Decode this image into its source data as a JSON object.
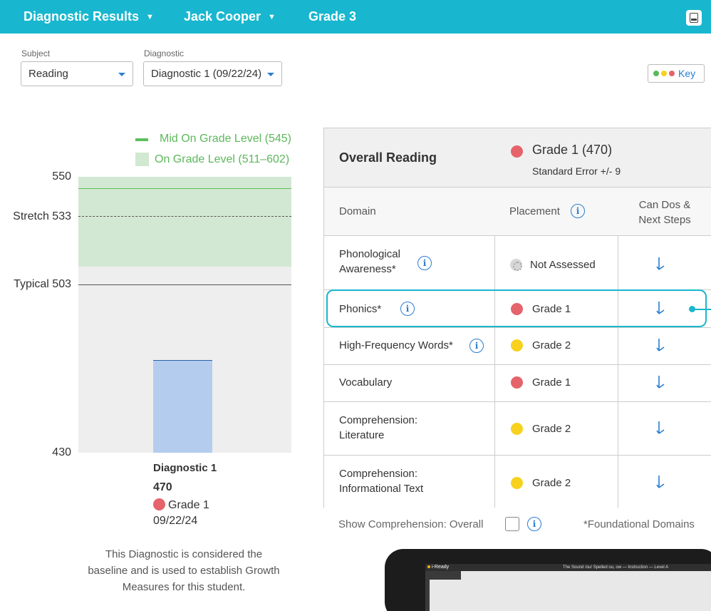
{
  "header": {
    "report": "Diagnostic Results",
    "student": "Jack Cooper",
    "grade": "Grade 3"
  },
  "filters": {
    "subject_label": "Subject",
    "subject_value": "Reading",
    "diagnostic_label": "Diagnostic",
    "diagnostic_value": "Diagnostic 1 (09/22/24)"
  },
  "key": {
    "label": "Key"
  },
  "colors": {
    "accent": "#18b7cf",
    "red": "#e5636a",
    "yellow": "#f7d11e",
    "green": "#e5636a",
    "link": "#2a7dd1"
  },
  "chart_data": {
    "type": "bar",
    "categories": [
      "Diagnostic 1"
    ],
    "values": [
      470
    ],
    "ylim": [
      430,
      550
    ],
    "legend": {
      "mid_on_grade": "Mid On Grade Level (545)",
      "on_grade": "On Grade Level (511–602)"
    },
    "reference_lines": [
      {
        "label": "Stretch 533",
        "value": 533,
        "style": "dashed"
      },
      {
        "label": "Typical 503",
        "value": 503,
        "style": "solid"
      },
      {
        "value": 545,
        "style": "green"
      }
    ],
    "band": [
      511,
      602
    ],
    "tick_labels": {
      "top": "550",
      "bottom": "430"
    },
    "caption": {
      "name": "Diagnostic 1",
      "score": "470",
      "placement": "Grade 1",
      "date": "09/22/24"
    }
  },
  "note": "This Diagnostic is considered the baseline and is used to establish Growth Measures for this student.",
  "table": {
    "overall_title": "Overall Reading",
    "overall_placement": "Grade 1 (470)",
    "standard_error": "Standard Error +/- 9",
    "col_domain": "Domain",
    "col_placement": "Placement",
    "col_next_line1": "Can Dos &",
    "col_next_line2": "Next Steps",
    "rows": [
      {
        "domain1": "Phonological",
        "domain2": "Awareness*",
        "placement": "Not Assessed",
        "status": "none"
      },
      {
        "domain1": "Phonics*",
        "domain2": "",
        "placement": "Grade 1",
        "status": "red"
      },
      {
        "domain1": "High-Frequency Words*",
        "domain2": "",
        "placement": "Grade 2",
        "status": "yellow"
      },
      {
        "domain1": "Vocabulary",
        "domain2": "",
        "placement": "Grade 1",
        "status": "red"
      },
      {
        "domain1": "Comprehension:",
        "domain2": "Literature",
        "placement": "Grade 2",
        "status": "yellow"
      },
      {
        "domain1": "Comprehension:",
        "domain2": "Informational Text",
        "placement": "Grade 2",
        "status": "yellow"
      }
    ]
  },
  "footer": {
    "show_comprehension": "Show Comprehension: Overall",
    "foundational_note": "*Foundational Domains"
  },
  "device": {
    "logo": "i-Ready",
    "title": "The Sound /ou/ Spelled ou, ow — Instruction — Level A"
  }
}
